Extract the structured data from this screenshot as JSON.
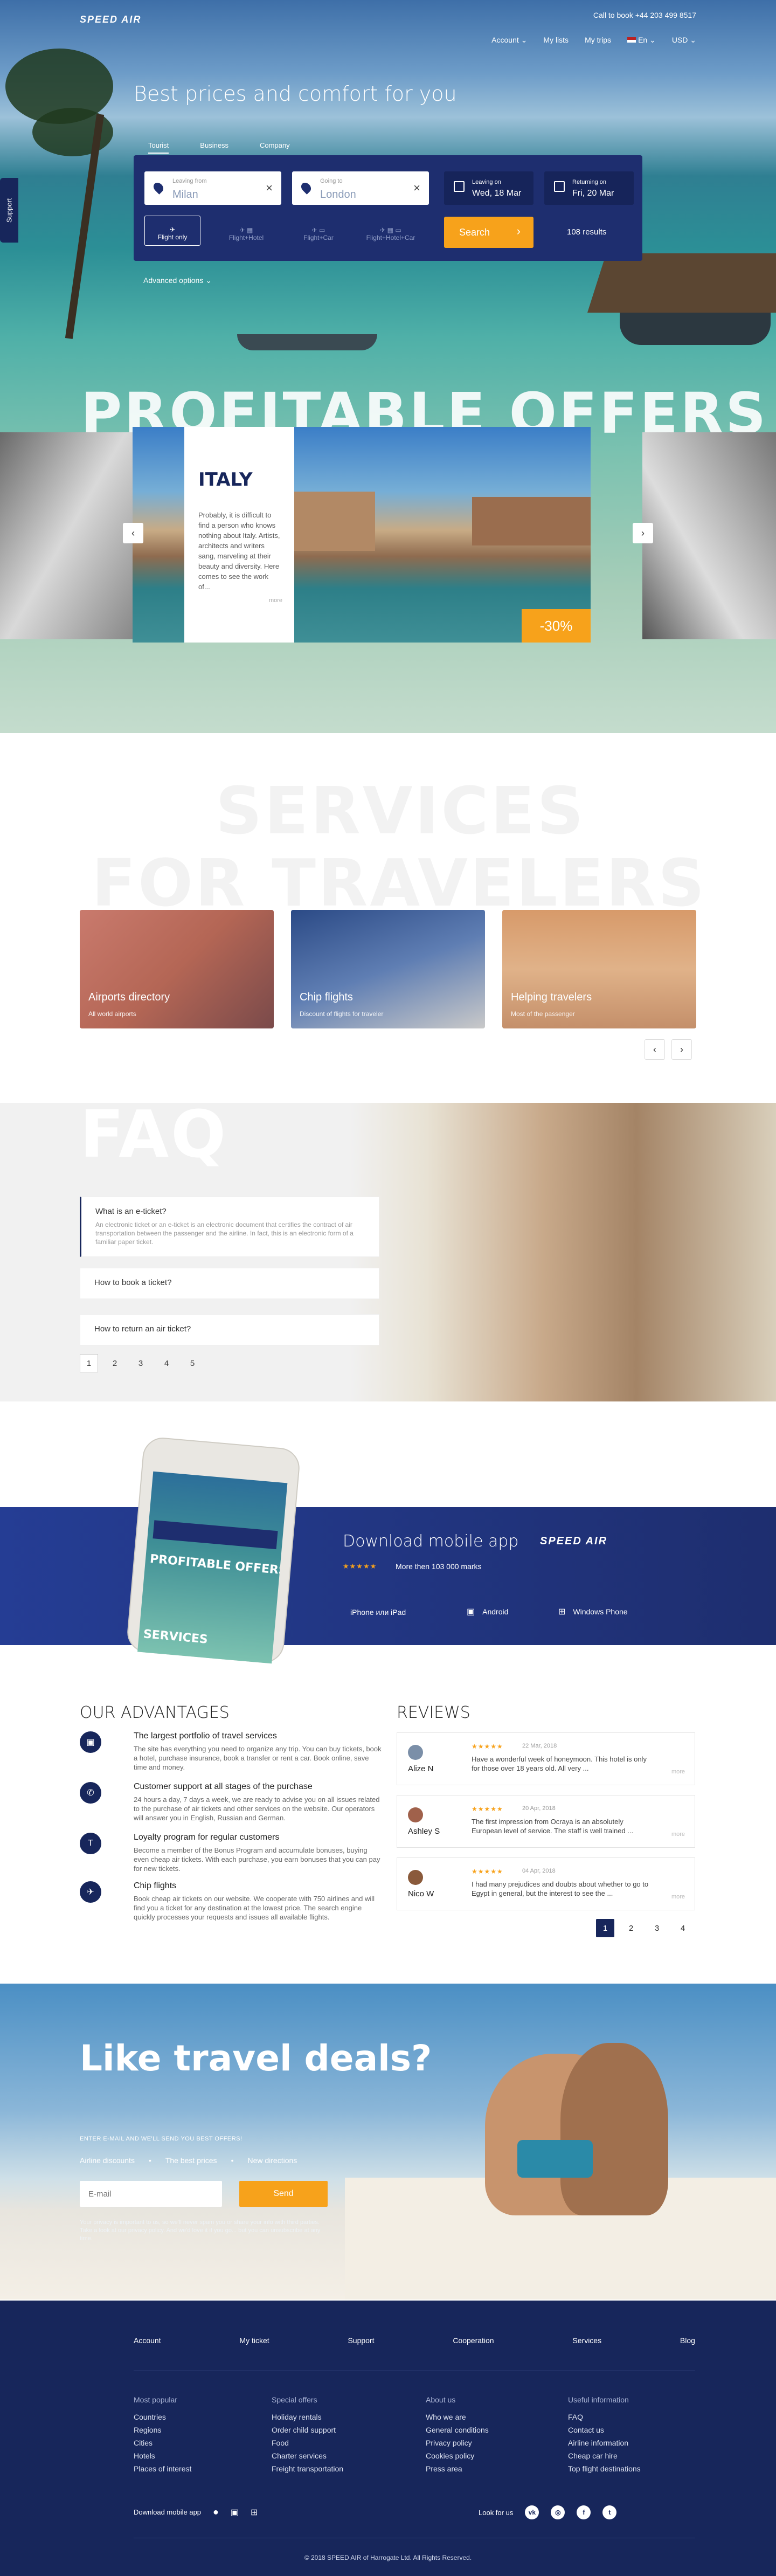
{
  "header": {
    "logo": "SPEED AIR",
    "phone": "Call to book  +44 203 499 8517",
    "nav": [
      "Account",
      "My lists",
      "My trips",
      "En",
      "USD"
    ],
    "support_tab": "Support"
  },
  "hero": {
    "headline": "Best prices and comfort for you",
    "tabs": [
      "Tourist",
      "Business",
      "Company"
    ],
    "from": {
      "label": "Leaving from",
      "value": "Milan"
    },
    "to": {
      "label": "Going to",
      "value": "London"
    },
    "leaving": {
      "label": "Leaving on",
      "value": "Wed, 18 Mar"
    },
    "returning": {
      "label": "Returning on",
      "value": "Fri, 20 Mar"
    },
    "modes": [
      "Flight only",
      "Flight+Hotel",
      "Flight+Car",
      "Flight+Hotel+Car"
    ],
    "search_label": "Search",
    "results": "108 results",
    "advanced": "Advanced options"
  },
  "offers": {
    "bg_word": "PROFITABLE OFFERS",
    "card_title": "ITALY",
    "card_text": "Probably, it is difficult to find a person who knows nothing about Italy. Artists, architects and writers sang, marveling at their beauty and diversity. Here comes to see the work of...",
    "more": "more",
    "discount": "-30%"
  },
  "services": {
    "bg_word_1": "SERVICES",
    "bg_word_2": "FOR TRAVELERS",
    "cards": [
      {
        "title": "Airports directory",
        "sub": "All world airports"
      },
      {
        "title": "Chip flights",
        "sub": "Discount of flights for traveler"
      },
      {
        "title": "Helping travelers",
        "sub": "Most of the passenger"
      }
    ]
  },
  "faq": {
    "bg_word": "FAQ",
    "items": [
      {
        "q": "What is an e-ticket?",
        "a": "An electronic ticket or an e-ticket is an electronic document that certifies the contract of air transportation between the passenger and the airline. In fact, this is an electronic form of a familiar paper ticket."
      },
      {
        "q": "How to book a ticket?"
      },
      {
        "q": "How to return an air ticket?"
      }
    ],
    "pages": [
      "1",
      "2",
      "3",
      "4",
      "5"
    ]
  },
  "app": {
    "title": "Download mobile app",
    "brand": "SPEED AIR",
    "stars": "★★★★★",
    "marks": "More then 103 000 marks",
    "platforms": [
      "iPhone или iPad",
      "Android",
      "Windows Phone"
    ],
    "phone_screen_word": "PROFITABLE OFFERS",
    "phone_screen_word2": "SERVICES"
  },
  "advantages": {
    "title": "OUR ADVANTAGES",
    "items": [
      {
        "h": "The largest portfolio of travel services",
        "d": "The site has everything you need to organize any trip. You can buy tickets, book a hotel, purchase insurance, book a transfer or rent a car. Book online, save time and money."
      },
      {
        "h": "Customer support at all stages of the purchase",
        "d": "24 hours a day, 7 days a week, we are ready to advise you on all issues related to the purchase of air tickets and other services on the website. Our operators will answer you in English, Russian and German."
      },
      {
        "h": "Loyalty program for regular customers",
        "d": "Become a member of the Bonus Program and accumulate bonuses, buying even cheap air tickets. With each purchase, you earn bonuses that you can pay for new tickets."
      },
      {
        "h": "Chip flights",
        "d": "Book cheap air tickets on our website. We cooperate with 750 airlines and will find you a ticket for any destination at the lowest price. The search engine quickly processes your requests and issues all available flights."
      }
    ]
  },
  "reviews": {
    "title": "REVIEWS",
    "items": [
      {
        "name": "Alize N",
        "stars": "★★★★★",
        "date": "22 Mar, 2018",
        "text": "Have a wonderful week of honeymoon. This hotel is only for those over 18 years old. All very ..."
      },
      {
        "name": "Ashley S",
        "stars": "★★★★★",
        "date": "20 Apr, 2018",
        "text": "The first impression from Ocraya is an absolutely European level of service. The staff is well trained ..."
      },
      {
        "name": "Nico W",
        "stars": "★★★★★",
        "date": "04 Apr, 2018",
        "text": "I had many prejudices and doubts about whether to go to Egypt in general, but the interest to see the ..."
      }
    ],
    "more": "more",
    "pages": [
      "1",
      "2",
      "3",
      "4"
    ]
  },
  "deals": {
    "title": "Like travel deals?",
    "subtitle": "ENTER E-MAIL AND WE'LL SEND YOU BEST OFFERS!",
    "perks": [
      "Airline discounts",
      "The best prices",
      "New directions"
    ],
    "email_placeholder": "E-mail",
    "send": "Send",
    "privacy": "Your privacy is important to us, so we'll never spam you or share your info with third parties. Take a look at our privacy policy. And we'd love it if you go... but you can unsubscribe at any time."
  },
  "footer": {
    "top_links": [
      "Account",
      "My ticket",
      "Support",
      "Cooperation",
      "Services",
      "Blog"
    ],
    "columns": [
      {
        "head": "Most popular",
        "links": [
          "Countries",
          "Regions",
          "Cities",
          "Hotels",
          "Places of interest"
        ]
      },
      {
        "head": "Special offers",
        "links": [
          "Holiday rentals",
          "Order child support",
          "Food",
          "Charter services",
          "Freight transportation"
        ]
      },
      {
        "head": "About us",
        "links": [
          "Who we are",
          "General conditions",
          "Privacy policy",
          "Cookies policy",
          "Press area"
        ]
      },
      {
        "head": "Useful information",
        "links": [
          "FAQ",
          "Contact us",
          "Airline information",
          "Cheap car hire",
          "Top flight destinations"
        ]
      }
    ],
    "download": "Download mobile app",
    "look": "Look for us",
    "copyright": "© 2018 SPEED AIR of Harrogate Ltd. All Rights Reserved."
  },
  "colors": {
    "navy": "#17265b",
    "accent": "#f7a21b",
    "panel": "#1e2e6f"
  }
}
